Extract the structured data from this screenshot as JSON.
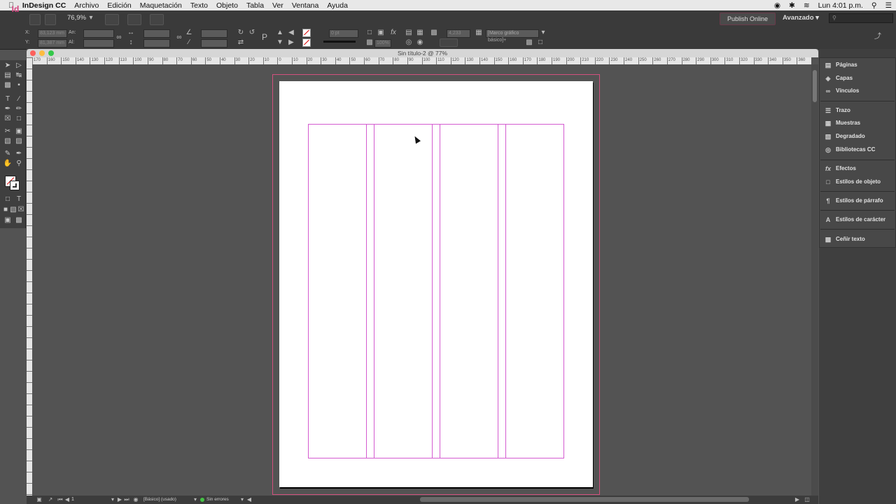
{
  "menubar": {
    "apple_icon": "apple-icon",
    "app_name": "InDesign CC",
    "items": [
      "Archivo",
      "Edición",
      "Maquetación",
      "Texto",
      "Objeto",
      "Tabla",
      "Ver",
      "Ventana",
      "Ayuda"
    ],
    "clock": "Lun 4:01 p.m."
  },
  "control": {
    "zoom": "76,9%",
    "x_label": "X:",
    "x_value": "83,123 mm",
    "y_label": "Y:",
    "y_value": "81,387 mm",
    "w_label": "An:",
    "h_label": "Al:",
    "stroke_weight": "0 pt",
    "opacity": "100%",
    "gap": "4,233 mm",
    "frame_style": "[Marco gráfico básico]+",
    "publish_label": "Publish Online",
    "workspace_label": "Avanzado",
    "search_placeholder": ""
  },
  "document": {
    "title": "Sin título-2 @ 77%",
    "ruler_ticks": [
      "170",
      "160",
      "150",
      "140",
      "130",
      "120",
      "110",
      "100",
      "90",
      "80",
      "70",
      "60",
      "50",
      "40",
      "30",
      "20",
      "10",
      "0",
      "10",
      "20",
      "30",
      "40",
      "50",
      "60",
      "70",
      "80",
      "90",
      "100",
      "110",
      "120",
      "130",
      "140",
      "150",
      "160",
      "170",
      "180",
      "190",
      "200",
      "210",
      "220",
      "230",
      "240",
      "250",
      "260",
      "270",
      "280",
      "290",
      "300",
      "310",
      "320",
      "330",
      "340",
      "350",
      "360"
    ]
  },
  "status": {
    "page_number": "1",
    "style": "[Básico] (usado)",
    "errors": "Sin errores"
  },
  "panels": [
    {
      "label": "Páginas",
      "icon": "pages-icon"
    },
    {
      "label": "Capas",
      "icon": "layers-icon"
    },
    {
      "label": "Vínculos",
      "icon": "links-icon"
    },
    {
      "label": "Trazo",
      "icon": "stroke-icon"
    },
    {
      "label": "Muestras",
      "icon": "swatches-icon"
    },
    {
      "label": "Degradado",
      "icon": "gradient-icon"
    },
    {
      "label": "Bibliotecas CC",
      "icon": "cc-libraries-icon"
    },
    {
      "label": "Efectos",
      "icon": "effects-icon"
    },
    {
      "label": "Estilos de objeto",
      "icon": "object-styles-icon"
    },
    {
      "label": "Estilos de párrafo",
      "icon": "paragraph-styles-icon"
    },
    {
      "label": "Estilos de carácter",
      "icon": "character-styles-icon"
    },
    {
      "label": "Ceñir texto",
      "icon": "text-wrap-icon"
    }
  ],
  "colors": {
    "margin_guide": "#d45bd0",
    "bleed": "#d2507e",
    "accent": "#d5437f"
  }
}
